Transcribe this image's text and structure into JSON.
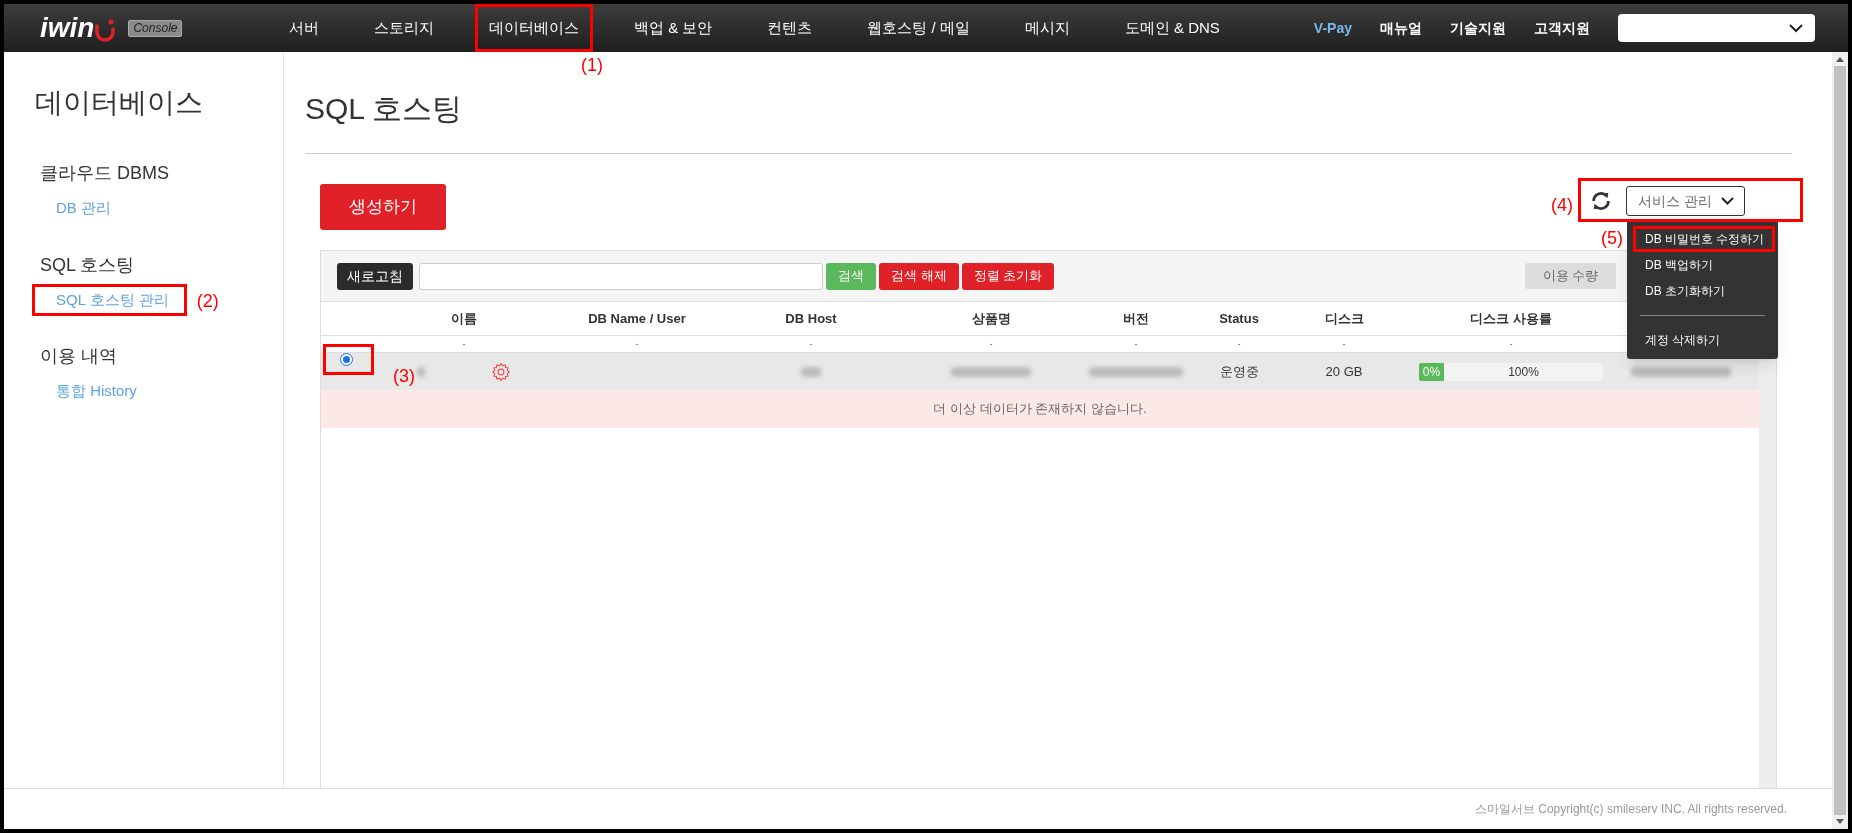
{
  "header": {
    "logo": "iwin",
    "logo_badge": "Console",
    "nav": [
      {
        "label": "서버"
      },
      {
        "label": "스토리지"
      },
      {
        "label": "데이터베이스"
      },
      {
        "label": "백업 & 보안"
      },
      {
        "label": "컨텐츠"
      },
      {
        "label": "웹호스팅 / 메일"
      },
      {
        "label": "메시지"
      },
      {
        "label": "도메인 & DNS"
      }
    ],
    "links": [
      {
        "label": "V-Pay",
        "kind": "highlight"
      },
      {
        "label": "매뉴얼",
        "kind": "plain"
      },
      {
        "label": "기술지원",
        "kind": "plain"
      },
      {
        "label": "고객지원",
        "kind": "plain"
      }
    ]
  },
  "sidebar": {
    "title": "데이터베이스",
    "groups": [
      {
        "heading": "클라우드 DBMS",
        "items": [
          {
            "label": "DB 관리"
          }
        ]
      },
      {
        "heading": "SQL 호스팅",
        "items": [
          {
            "label": "SQL 호스팅 관리"
          }
        ]
      },
      {
        "heading": "이용 내역",
        "items": [
          {
            "label": "통합 History"
          }
        ]
      }
    ]
  },
  "main": {
    "title": "SQL 호스팅",
    "create_button": "생성하기",
    "service_menu": {
      "label": "서비스 관리",
      "expanded": true,
      "items": [
        {
          "kind": "item",
          "label": "DB 비밀번호 수정하기"
        },
        {
          "kind": "item",
          "label": "DB 백업하기"
        },
        {
          "kind": "item",
          "label": "DB 초기화하기"
        },
        {
          "kind": "divider"
        },
        {
          "kind": "item",
          "label": "계정 삭제하기"
        }
      ]
    },
    "toolbar": {
      "refresh_button": "새로고침",
      "buttons": [
        {
          "label": "검색",
          "kind": "success"
        },
        {
          "label": "검색 해제",
          "kind": "danger"
        },
        {
          "label": "정렬 초기화",
          "kind": "danger"
        }
      ],
      "view_toggle": [
        {
          "label": "이용 수량",
          "selected": false
        }
      ]
    },
    "table": {
      "columns": [
        "이름",
        "DB Name / User",
        "DB Host",
        "상품명",
        "버전",
        "Status",
        "디스크",
        "디스크 사용률"
      ],
      "filter_row": [
        "-",
        "-",
        "-",
        "-",
        "-",
        "-",
        "-",
        "-"
      ],
      "rows": [
        {
          "selected": true,
          "status": "운영중",
          "disk": "20 GB",
          "usage": {
            "level": 0,
            "used": "0%",
            "remaining": "100%"
          }
        }
      ],
      "empty_message": "더 이상 데이터가 존재하지 않습니다."
    }
  },
  "callouts": [
    {
      "label": "(1)"
    },
    {
      "label": "(2)"
    },
    {
      "label": "(3)"
    },
    {
      "label": "(4)"
    },
    {
      "label": "(5)"
    }
  ],
  "footer": {
    "copyright": "스마일서브 Copyright(c) smileserv INC. All rights reserved."
  }
}
